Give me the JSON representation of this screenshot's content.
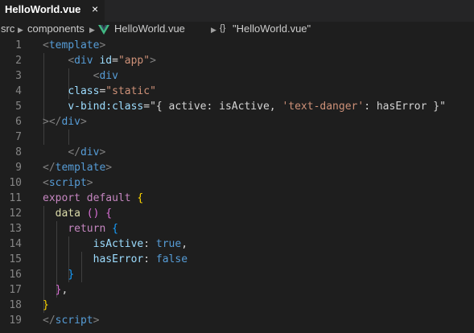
{
  "tab": {
    "title": "HelloWorld.vue",
    "close": "×"
  },
  "breadcrumb": {
    "items": [
      "src",
      "components",
      "HelloWorld.vue",
      "\"HelloWorld.vue\""
    ],
    "object_symbol": "{}"
  },
  "editor": {
    "line_numbers": [
      "1",
      "2",
      "3",
      "4",
      "5",
      "6",
      "7",
      "8",
      "9",
      "10",
      "11",
      "12",
      "13",
      "14",
      "15",
      "16",
      "17",
      "18",
      "19"
    ],
    "lines": [
      [
        {
          "t": "<",
          "c": "t-br"
        },
        {
          "t": "template",
          "c": "t-tag"
        },
        {
          "t": ">",
          "c": "t-br"
        }
      ],
      [
        {
          "t": "    "
        },
        {
          "t": "<",
          "c": "t-br"
        },
        {
          "t": "div",
          "c": "t-tag"
        },
        {
          "t": " "
        },
        {
          "t": "id",
          "c": "t-attr"
        },
        {
          "t": "=",
          "c": "t-txt"
        },
        {
          "t": "\"app\"",
          "c": "t-str"
        },
        {
          "t": ">",
          "c": "t-br"
        }
      ],
      [
        {
          "t": "        "
        },
        {
          "t": "<",
          "c": "t-br"
        },
        {
          "t": "div",
          "c": "t-tag"
        }
      ],
      [
        {
          "t": "    "
        },
        {
          "t": "class",
          "c": "t-attr"
        },
        {
          "t": "=",
          "c": "t-txt"
        },
        {
          "t": "\"static\"",
          "c": "t-str"
        }
      ],
      [
        {
          "t": "    "
        },
        {
          "t": "v-bind:class",
          "c": "t-attr"
        },
        {
          "t": "=",
          "c": "t-txt"
        },
        {
          "t": "\"{ active: isActive, ",
          "c": "t-txt"
        },
        {
          "t": "'text-danger'",
          "c": "t-str"
        },
        {
          "t": ": hasError }\"",
          "c": "t-txt"
        }
      ],
      [
        {
          "t": ">",
          "c": "t-br"
        },
        {
          "t": "</",
          "c": "t-br"
        },
        {
          "t": "div",
          "c": "t-tag"
        },
        {
          "t": ">",
          "c": "t-br"
        }
      ],
      [
        {
          "t": ""
        }
      ],
      [
        {
          "t": "    "
        },
        {
          "t": "</",
          "c": "t-br"
        },
        {
          "t": "div",
          "c": "t-tag"
        },
        {
          "t": ">",
          "c": "t-br"
        }
      ],
      [
        {
          "t": "</",
          "c": "t-br"
        },
        {
          "t": "template",
          "c": "t-tag"
        },
        {
          "t": ">",
          "c": "t-br"
        }
      ],
      [
        {
          "t": "<",
          "c": "t-br"
        },
        {
          "t": "script",
          "c": "t-tag"
        },
        {
          "t": ">",
          "c": "t-br"
        }
      ],
      [
        {
          "t": "export",
          "c": "t-kw"
        },
        {
          "t": " "
        },
        {
          "t": "default",
          "c": "t-kw"
        },
        {
          "t": " "
        },
        {
          "t": "{",
          "c": "t-b1"
        }
      ],
      [
        {
          "t": "  "
        },
        {
          "t": "data",
          "c": "t-fn"
        },
        {
          "t": " "
        },
        {
          "t": "()",
          "c": "t-b2"
        },
        {
          "t": " "
        },
        {
          "t": "{",
          "c": "t-b2"
        }
      ],
      [
        {
          "t": "    "
        },
        {
          "t": "return",
          "c": "t-kw"
        },
        {
          "t": " "
        },
        {
          "t": "{",
          "c": "t-b3"
        }
      ],
      [
        {
          "t": "        "
        },
        {
          "t": "isActive",
          "c": "t-prop"
        },
        {
          "t": ": ",
          "c": "t-txt"
        },
        {
          "t": "true",
          "c": "t-bool"
        },
        {
          "t": ",",
          "c": "t-txt"
        }
      ],
      [
        {
          "t": "        "
        },
        {
          "t": "hasError",
          "c": "t-prop"
        },
        {
          "t": ": ",
          "c": "t-txt"
        },
        {
          "t": "false",
          "c": "t-bool"
        }
      ],
      [
        {
          "t": "    "
        },
        {
          "t": "}",
          "c": "t-b3"
        }
      ],
      [
        {
          "t": "  "
        },
        {
          "t": "}",
          "c": "t-b2"
        },
        {
          "t": ",",
          "c": "t-txt"
        }
      ],
      [
        {
          "t": "}",
          "c": "t-b1"
        }
      ],
      [
        {
          "t": "</",
          "c": "t-br"
        },
        {
          "t": "script",
          "c": "t-tag"
        },
        {
          "t": ">",
          "c": "t-br"
        }
      ]
    ]
  },
  "colors": {
    "background": "#1e1e1e",
    "tab_bar": "#252526",
    "vue_green": "#41b883"
  }
}
